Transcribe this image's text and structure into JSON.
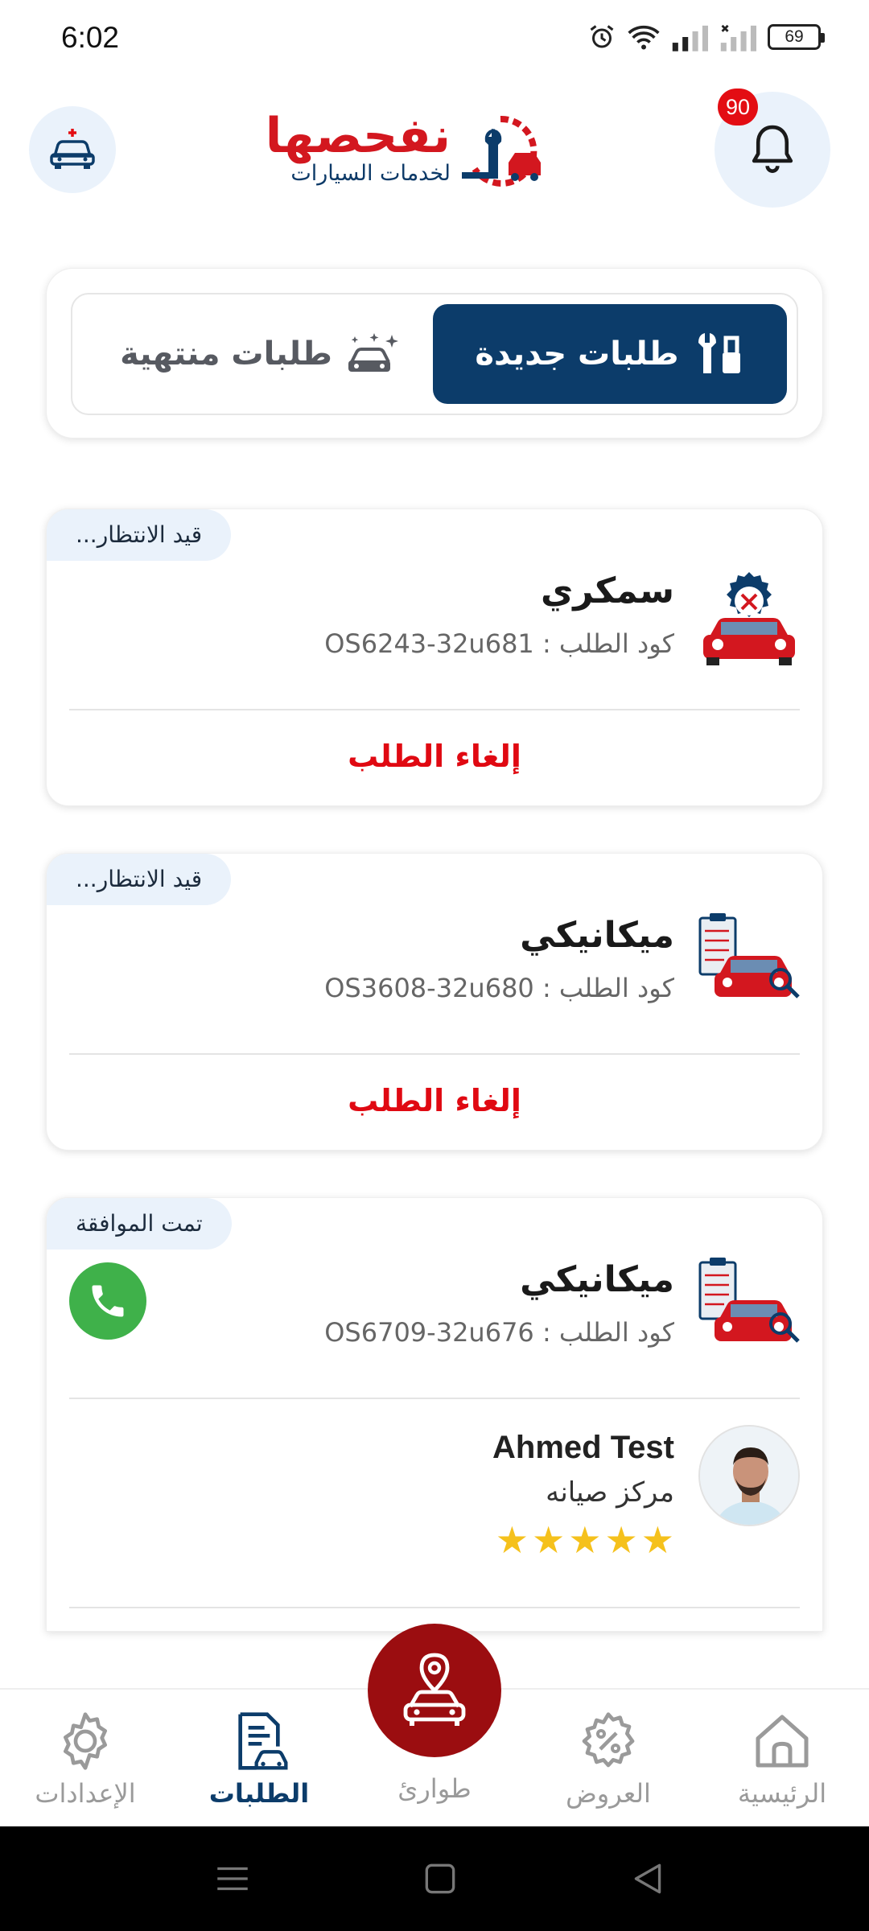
{
  "status_bar": {
    "time": "6:02",
    "battery": "69"
  },
  "header": {
    "logo_title": "نفحصها",
    "logo_subtitle": "لخدمات السيارات",
    "notification_count": "90"
  },
  "tabs": {
    "active_label": "طلبات جديدة",
    "inactive_label": "طلبات منتهية"
  },
  "orders": [
    {
      "status": "قيد الانتظار...",
      "service": "سمكري",
      "code": "كود الطلب : OS6243-32u681",
      "action": "إلغاء الطلب"
    },
    {
      "status": "قيد الانتظار...",
      "service": "ميكانيكي",
      "code": "كود الطلب : OS3608-32u680",
      "action": "إلغاء الطلب"
    },
    {
      "status": "تمت الموافقة",
      "service": "ميكانيكي",
      "code": "كود الطلب : OS6709-32u676",
      "provider": {
        "name": "Ahmed Test",
        "type": "مركز صيانه",
        "rating": 5
      }
    }
  ],
  "bottom_nav": {
    "settings": "الإعدادات",
    "orders": "الطلبات",
    "emergency": "طوارئ",
    "offers": "العروض",
    "home": "الرئيسية"
  },
  "colors": {
    "primary": "#0c3c6a",
    "danger": "#e00912",
    "emergency": "#9b0d10",
    "call": "#3fb14a",
    "star": "#f5c11c",
    "pill_bg": "#eaf2fb"
  }
}
